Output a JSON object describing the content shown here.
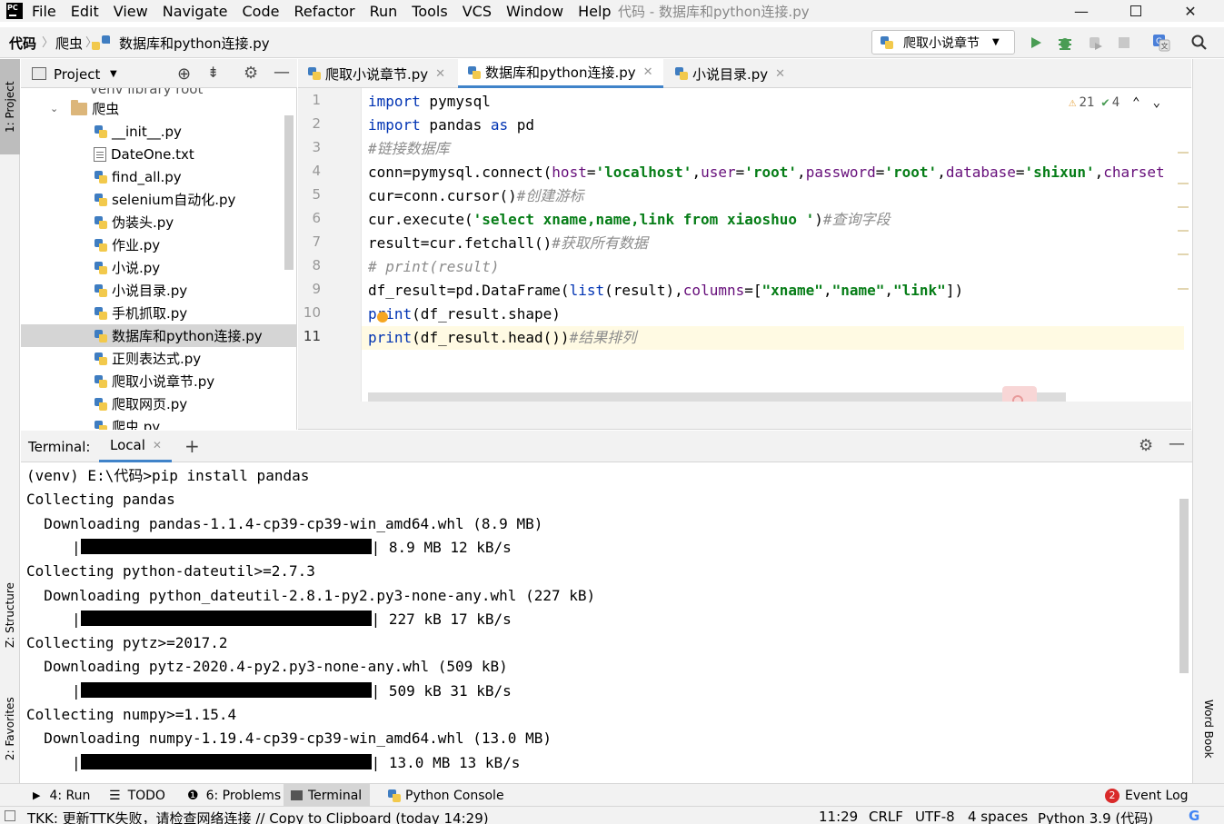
{
  "menubar": {
    "app_icon_text": "PC",
    "items": [
      "File",
      "Edit",
      "View",
      "Navigate",
      "Code",
      "Refactor",
      "Run",
      "Tools",
      "VCS",
      "Window",
      "Help"
    ],
    "window_title": "代码 - 数据库和python连接.py"
  },
  "navbar": {
    "crumbs": [
      "代码",
      "爬虫",
      "数据库和python连接.py"
    ],
    "run_config": "爬取小说章节"
  },
  "left_strip": {
    "project": "1: Project",
    "structure": "Z: Structure",
    "favorites": "2: Favorites"
  },
  "right_strip": {
    "word_book": "Word Book"
  },
  "project_panel": {
    "title": "Project",
    "partial_row": "venv library root",
    "folder": "爬虫",
    "files": [
      {
        "name": "__init__.py",
        "type": "py"
      },
      {
        "name": "DateOne.txt",
        "type": "txt"
      },
      {
        "name": "find_all.py",
        "type": "py"
      },
      {
        "name": "selenium自动化.py",
        "type": "py"
      },
      {
        "name": "伪装头.py",
        "type": "py"
      },
      {
        "name": "作业.py",
        "type": "py"
      },
      {
        "name": "小说.py",
        "type": "py"
      },
      {
        "name": "小说目录.py",
        "type": "py"
      },
      {
        "name": "手机抓取.py",
        "type": "py"
      },
      {
        "name": "数据库和python连接.py",
        "type": "py",
        "selected": true
      },
      {
        "name": "正则表达式.py",
        "type": "py"
      },
      {
        "name": "爬取小说章节.py",
        "type": "py"
      },
      {
        "name": "爬取网页.py",
        "type": "py"
      },
      {
        "name": "爬虫.py",
        "type": "py"
      }
    ]
  },
  "editor": {
    "tabs": [
      {
        "label": "爬取小说章节.py",
        "active": false
      },
      {
        "label": "数据库和python连接.py",
        "active": true
      },
      {
        "label": "小说目录.py",
        "active": false
      }
    ],
    "inspections": {
      "warnings": "21",
      "typos": "4"
    },
    "line_numbers": [
      "1",
      "2",
      "3",
      "4",
      "5",
      "6",
      "7",
      "8",
      "9",
      "10",
      "11"
    ]
  },
  "terminal": {
    "label": "Terminal:",
    "tab": "Local",
    "lines": [
      "(venv) E:\\代码>pip install pandas",
      "Collecting pandas",
      "  Downloading pandas-1.1.4-cp39-cp39-win_amd64.whl (8.9 MB)",
      "| 8.9 MB 12 kB/s",
      "Collecting python-dateutil>=2.7.3",
      "  Downloading python_dateutil-2.8.1-py2.py3-none-any.whl (227 kB)",
      "| 227 kB 17 kB/s",
      "Collecting pytz>=2017.2",
      "  Downloading pytz-2020.4-py2.py3-none-any.whl (509 kB)",
      "| 509 kB 31 kB/s",
      "Collecting numpy>=1.15.4",
      "  Downloading numpy-1.19.4-cp39-cp39-win_amd64.whl (13.0 MB)",
      "| 13.0 MB 13 kB/s"
    ],
    "progress_rows": [
      3,
      6,
      9,
      12
    ],
    "progress": 1.0
  },
  "bottom_tools": {
    "run": "4: Run",
    "todo": "TODO",
    "problems": "6: Problems",
    "terminal": "Terminal",
    "python_console": "Python Console",
    "event_log_count": "2",
    "event_log": "Event Log"
  },
  "status": {
    "message": "TKK: 更新TTK失败，请检查网络连接 // Copy to Clipboard (today 14:29)",
    "position": "11:29",
    "line_sep": "CRLF",
    "encoding": "UTF-8",
    "indent": "4 spaces",
    "interpreter": "Python 3.9 (代码)"
  },
  "colors": {
    "accent": "#4083c9",
    "keyword": "#0033b3",
    "string": "#067d17",
    "comment": "#8c8c8c"
  }
}
